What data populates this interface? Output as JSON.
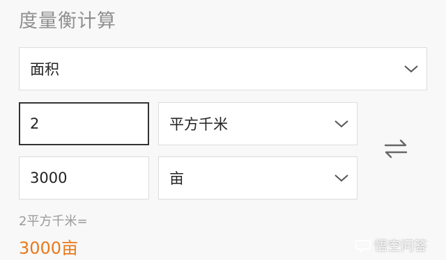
{
  "page": {
    "title": "度量衡计算"
  },
  "category": {
    "selected": "面积"
  },
  "converter": {
    "from_value": "2",
    "from_unit": "平方千米",
    "to_value": "3000",
    "to_unit": "亩"
  },
  "result": {
    "expression": "2平方千米=",
    "value": "3000亩"
  },
  "watermark": {
    "text": "悟空问答"
  },
  "icons": {
    "dropdown": "chevron-down-icon",
    "swap": "swap-icon",
    "watermark": "speech-bubble-icon"
  },
  "colors": {
    "result": "#e8781a"
  }
}
